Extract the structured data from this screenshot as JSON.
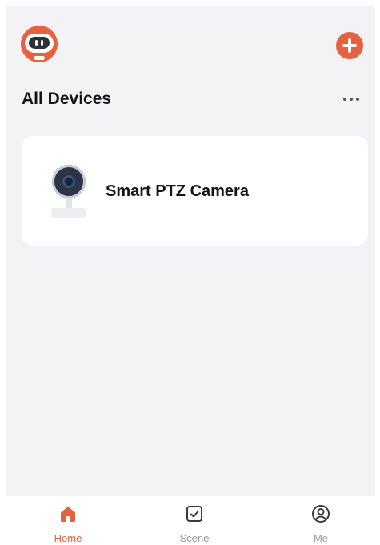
{
  "header": {
    "avatar_icon": "robot-avatar-icon",
    "add_icon": "plus-circle-icon"
  },
  "section": {
    "title": "All Devices",
    "more_icon": "more-dots-icon"
  },
  "devices": [
    {
      "name": "Smart PTZ Camera",
      "icon": "camera-icon"
    }
  ],
  "tabs": [
    {
      "label": "Home",
      "icon": "home-icon",
      "active": true
    },
    {
      "label": "Scene",
      "icon": "checkbox-icon",
      "active": false
    },
    {
      "label": "Me",
      "icon": "profile-icon",
      "active": false
    }
  ],
  "colors": {
    "accent": "#e8603c",
    "background": "#f3f3f5",
    "card": "#ffffff",
    "text": "#151515",
    "inactive": "#9a9a9e"
  }
}
